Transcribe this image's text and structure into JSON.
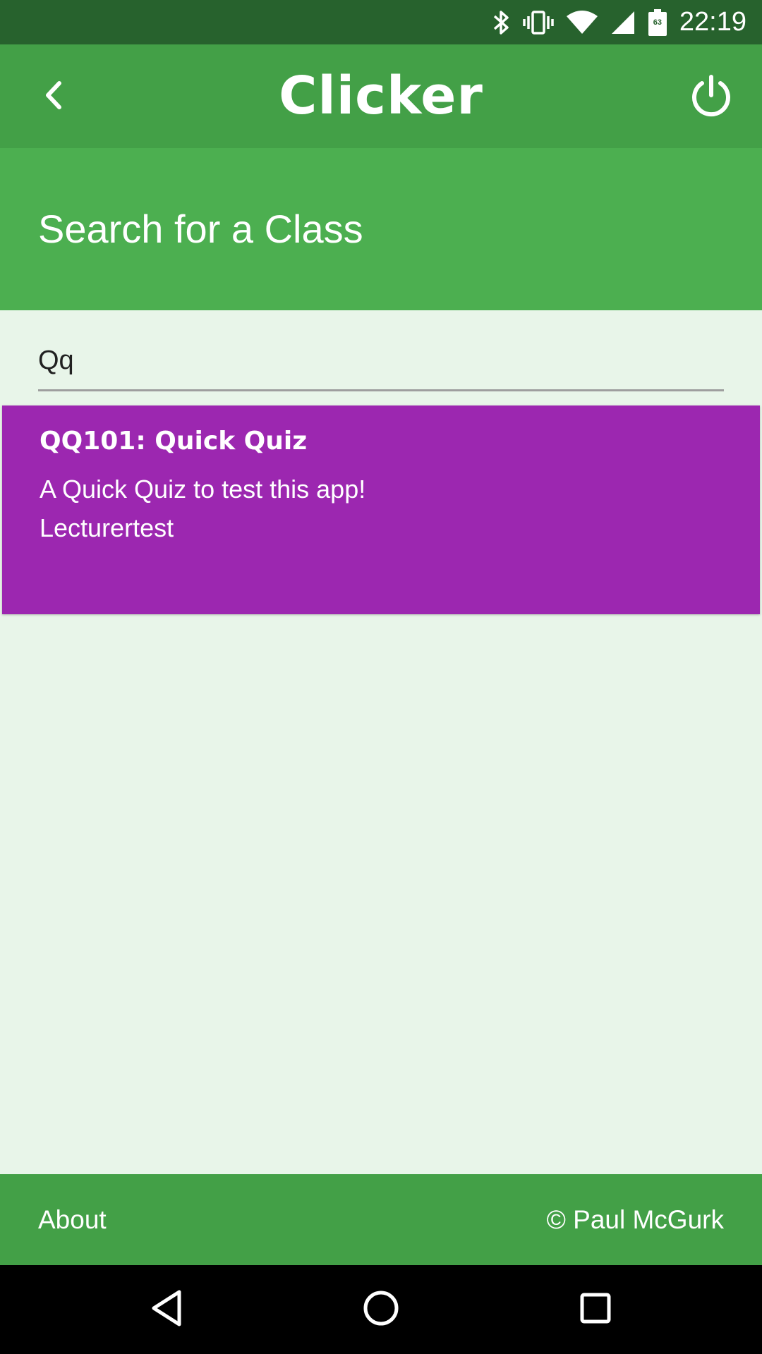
{
  "status_bar": {
    "time": "22:19",
    "battery_percent": "63",
    "icons": [
      "bluetooth-icon",
      "vibrate-icon",
      "wifi-icon",
      "signal-icon",
      "battery-icon"
    ]
  },
  "app_bar": {
    "title": "Clicker",
    "back_icon": "chevron-left-icon",
    "power_icon": "power-icon"
  },
  "section": {
    "title": "Search for a Class"
  },
  "search": {
    "value": "Qq",
    "placeholder": ""
  },
  "results": [
    {
      "title": "QQ101: Quick Quiz",
      "description": "A Quick Quiz to test this app!",
      "owner": "Lecturertest"
    }
  ],
  "footer": {
    "about_label": "About",
    "copyright": "© Paul McGurk"
  },
  "nav_bar": {
    "icons": [
      "back-triangle-icon",
      "home-circle-icon",
      "recents-square-icon"
    ]
  },
  "colors": {
    "status_bar": "#27622d",
    "app_bar": "#43a047",
    "section_header": "#4caf50",
    "background": "#e8f5e9",
    "card": "#9c27b0",
    "footer": "#43a047",
    "nav_bar": "#000000"
  }
}
